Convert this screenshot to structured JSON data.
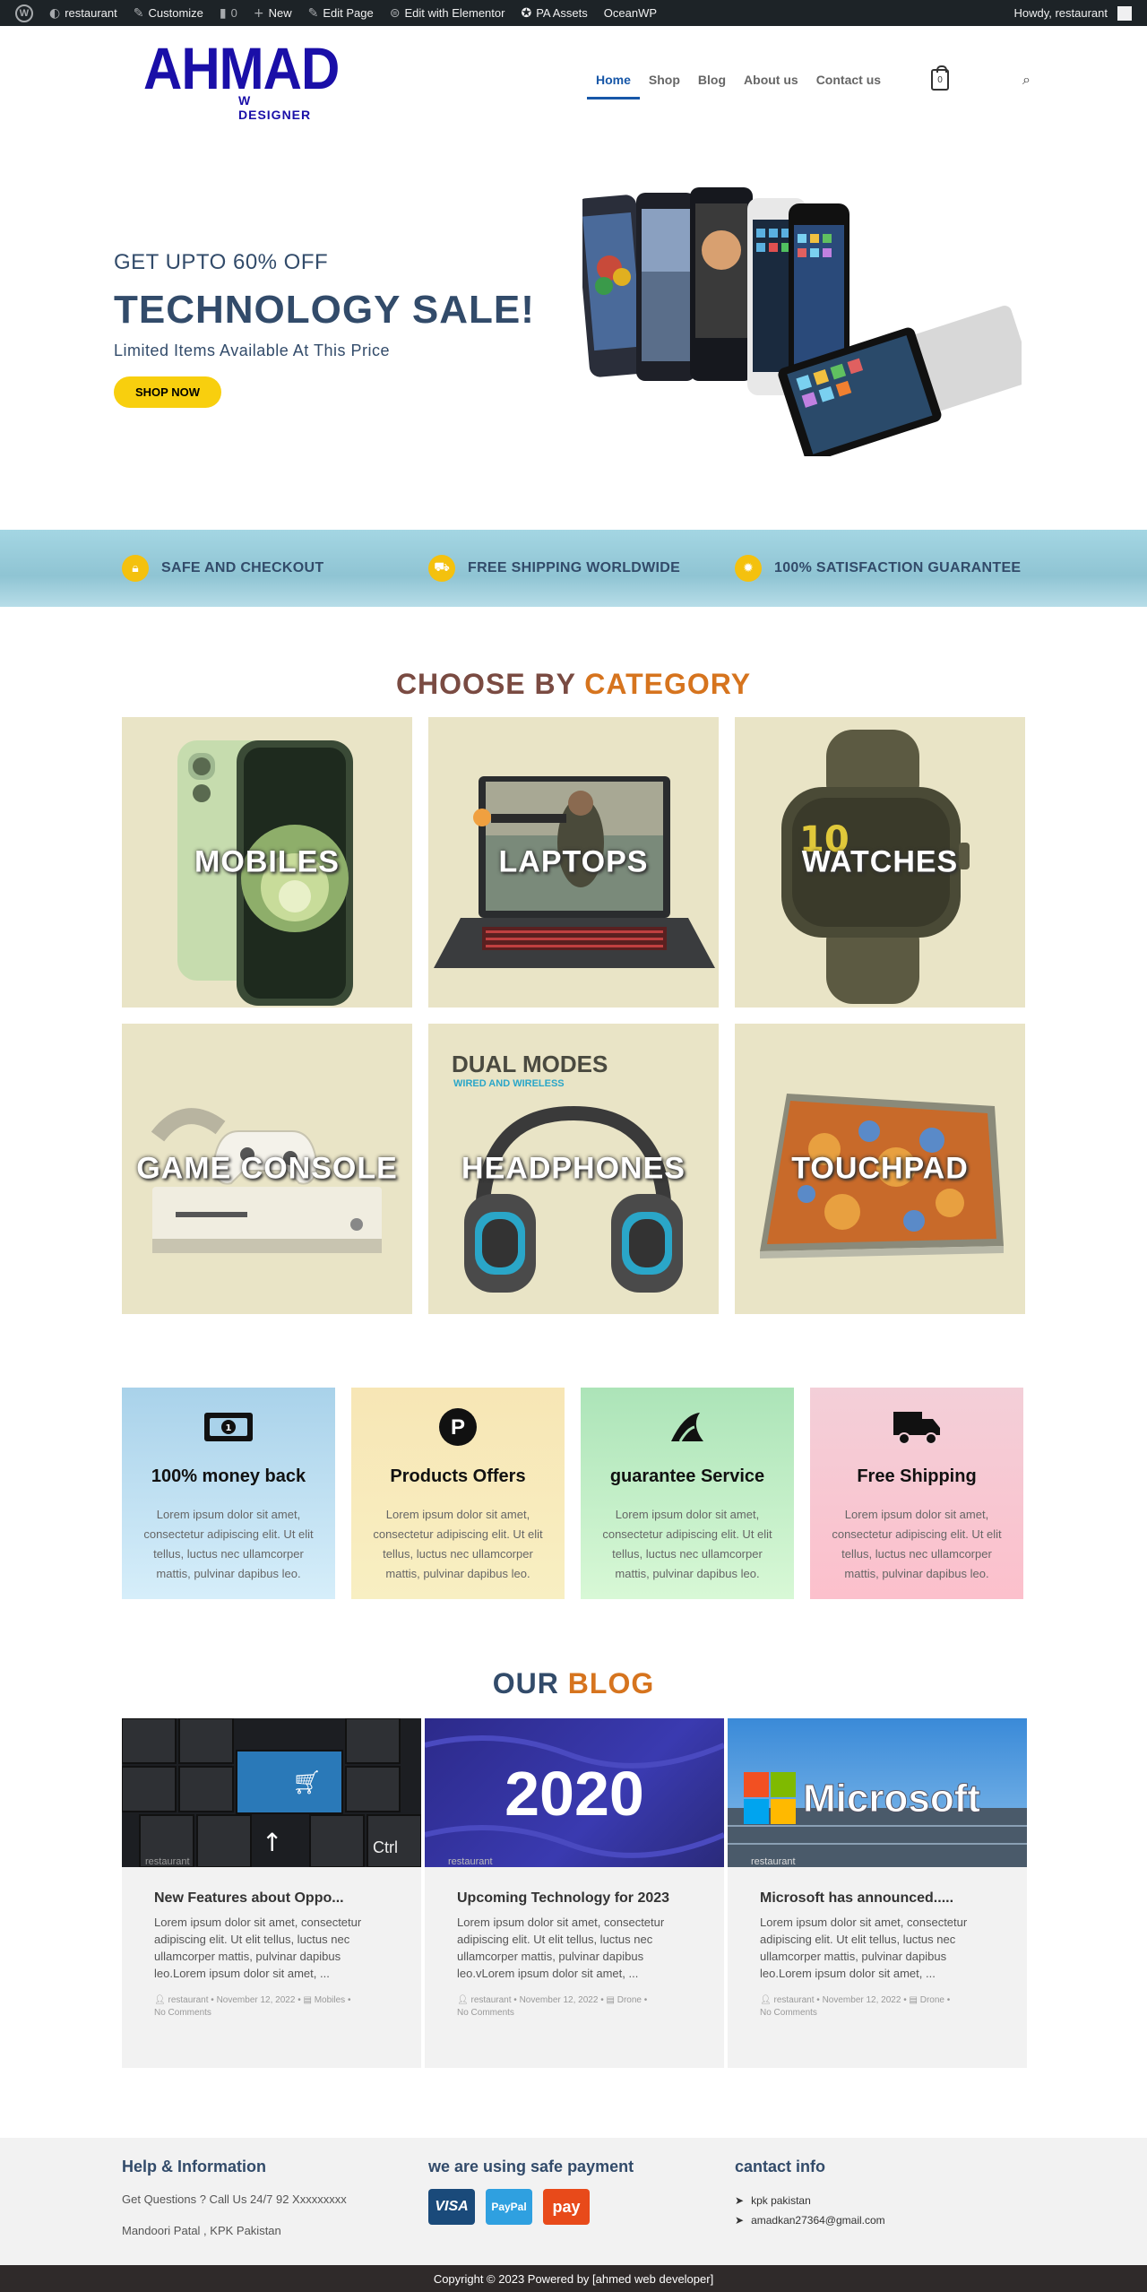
{
  "adminbar": {
    "site": "restaurant",
    "customize": "Customize",
    "comments": "0",
    "new": "New",
    "edit_page": "Edit Page",
    "elementor": "Edit with Elementor",
    "pa_assets": "PA Assets",
    "oceanwp": "OceanWP",
    "howdy": "Howdy, restaurant"
  },
  "header": {
    "logo_main": "AHMAD",
    "logo_sub": "W DESIGNER",
    "nav": [
      "Home",
      "Shop",
      "Blog",
      "About us",
      "Contact us"
    ],
    "cart_count": "0"
  },
  "hero": {
    "subtitle": "GET UPTO 60% OFF",
    "title": "TECHNOLOGY SALE!",
    "limited": "Limited Items Available At This Price",
    "button": "SHOP NOW"
  },
  "features": [
    {
      "label": "SAFE AND CHECKOUT",
      "icon": "lock-icon"
    },
    {
      "label": "FREE SHIPPING WORLDWIDE",
      "icon": "truck-icon"
    },
    {
      "label": "100% SATISFACTION GUARANTEE",
      "icon": "badge-icon"
    }
  ],
  "categories": {
    "title_1": "CHOOSE BY",
    "title_2": "CATEGORY",
    "items": [
      "MOBILES",
      "LAPTOPS",
      "WATCHES",
      "GAME CONSOLE",
      "HEADPHONES",
      "TOUCHPAD"
    ],
    "headphone_banner": "DUAL MODES",
    "headphone_banner_sub": "WIRED AND WIRELESS",
    "watch_face": "10"
  },
  "services": [
    {
      "title": "100% money back",
      "text": "Lorem ipsum dolor sit amet, consectetur adipiscing elit. Ut elit tellus, luctus nec ullamcorper mattis, pulvinar dapibus leo.",
      "icon": "money-icon",
      "bg_top": "#a9d2ea",
      "bg_bottom": "#d6eefa"
    },
    {
      "title": "Products Offers",
      "text": "Lorem ipsum dolor sit amet, consectetur adipiscing elit. Ut elit tellus, luctus nec ullamcorper mattis, pulvinar dapibus leo.",
      "icon": "parking-icon",
      "bg_top": "#f7e6b5",
      "bg_bottom": "#f8efc2"
    },
    {
      "title": "guarantee Service",
      "text": "Lorem ipsum dolor sit amet, consectetur adipiscing elit. Ut elit tellus, luctus nec ullamcorper mattis, pulvinar dapibus leo.",
      "icon": "shark-fin-icon",
      "bg_top": "#ace4b8",
      "bg_bottom": "#d8f8d6"
    },
    {
      "title": "Free Shipping",
      "text": "Lorem ipsum dolor sit amet, consectetur adipiscing elit. Ut elit tellus, luctus nec ullamcorper mattis, pulvinar dapibus leo.",
      "icon": "delivery-truck-icon",
      "bg_top": "#f3cfd8",
      "bg_bottom": "#fcc0cc"
    }
  ],
  "blog": {
    "title_1": "OUR",
    "title_2": "BLOG",
    "posts": [
      {
        "title": "New Features about Oppo...",
        "excerpt": "Lorem ipsum dolor sit amet, consectetur adipiscing elit. Ut elit tellus, luctus nec ullamcorper mattis, pulvinar dapibus leo.Lorem ipsum dolor sit amet, ...",
        "author": "restaurant",
        "date": "November 12, 2022",
        "category": "Mobiles",
        "comments": "No Comments",
        "image_alt": "restaurant"
      },
      {
        "title": "Upcoming Technology for 2023",
        "excerpt": "Lorem ipsum dolor sit amet, consectetur adipiscing elit. Ut elit tellus, luctus nec ullamcorper mattis, pulvinar dapibus leo.vLorem ipsum dolor sit amet, ...",
        "author": "restaurant",
        "date": "November 12, 2022",
        "category": "Drone",
        "comments": "No Comments",
        "image_alt": "restaurant",
        "image_text": "2020"
      },
      {
        "title": "Microsoft has announced.....",
        "excerpt": "Lorem ipsum dolor sit amet, consectetur adipiscing elit. Ut elit tellus, luctus nec ullamcorper mattis, pulvinar dapibus leo.Lorem ipsum dolor sit amet, ...",
        "author": "restaurant",
        "date": "November 12, 2022",
        "category": "Drone",
        "comments": "No Comments",
        "image_alt": "restaurant",
        "image_text": "Microsoft"
      }
    ]
  },
  "footer": {
    "help_title": "Help & Information",
    "help_call": "Get Questions ? Call Us 24/7 92 Xxxxxxxxx",
    "help_address": "Mandoori Patal , KPK Pakistan",
    "payment_title": "we are using safe payment",
    "payments": [
      "VISA",
      "PayPal",
      "pay"
    ],
    "contact_title": "cantact info",
    "contact_location": "kpk pakistan",
    "contact_email": "amadkan27364@gmail.com",
    "copyright": "Copyright © 2023 Powered by [ahmed web developer]"
  },
  "colors": {
    "brand_blue": "#1a0fa8",
    "accent_yellow": "#f8cf0e",
    "title_navy": "#324b6a",
    "title_orange": "#d6741e"
  }
}
